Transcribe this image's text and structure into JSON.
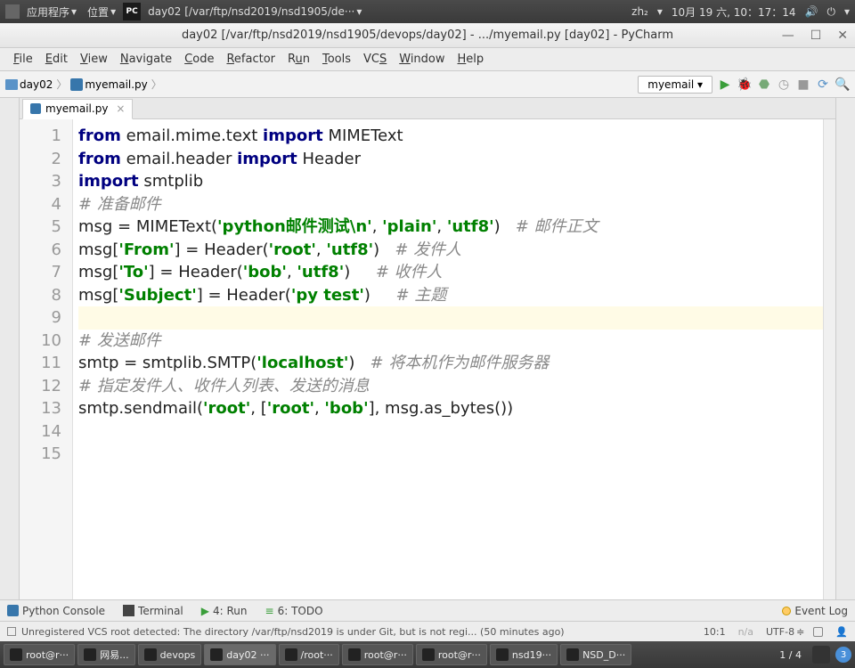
{
  "syspanel": {
    "apps": "应用程序",
    "places": "位置",
    "win_menu": "day02 [/var/ftp/nsd2019/nsd1905/de···",
    "ime": "zh₂",
    "date": "10月 19 六, 10：17：14"
  },
  "title": "day02 [/var/ftp/nsd2019/nsd1905/devops/day02] - .../myemail.py [day02] - PyCharm",
  "menus": [
    "File",
    "Edit",
    "View",
    "Navigate",
    "Code",
    "Refactor",
    "Run",
    "Tools",
    "VCS",
    "Window",
    "Help"
  ],
  "breadcrumb": {
    "root": "day02",
    "file": "myemail.py"
  },
  "run_config": "myemail",
  "file_tab": "myemail.py",
  "code": {
    "lines": [
      [
        [
          "kw",
          "from"
        ],
        [
          "",
          " email.mime.text "
        ],
        [
          "kw",
          "import"
        ],
        [
          "",
          " MIMEText"
        ]
      ],
      [
        [
          "kw",
          "from"
        ],
        [
          "",
          " email.header "
        ],
        [
          "kw",
          "import"
        ],
        [
          "",
          " Header"
        ]
      ],
      [
        [
          "kw",
          "import"
        ],
        [
          "",
          " smtplib"
        ]
      ],
      [
        [
          "",
          ""
        ]
      ],
      [
        [
          "cmt",
          "# 准备邮件"
        ]
      ],
      [
        [
          "",
          "msg = MIMEText("
        ],
        [
          "str",
          "'python邮件测试\\n'"
        ],
        [
          "",
          ", "
        ],
        [
          "str",
          "'plain'"
        ],
        [
          "",
          ", "
        ],
        [
          "str",
          "'utf8'"
        ],
        [
          "",
          ")   "
        ],
        [
          "cmt",
          "# 邮件正文"
        ]
      ],
      [
        [
          "",
          "msg["
        ],
        [
          "str",
          "'From'"
        ],
        [
          "",
          "] = Header("
        ],
        [
          "str",
          "'root'"
        ],
        [
          "",
          ", "
        ],
        [
          "str",
          "'utf8'"
        ],
        [
          "",
          ")   "
        ],
        [
          "cmt",
          "# 发件人"
        ]
      ],
      [
        [
          "",
          "msg["
        ],
        [
          "str",
          "'To'"
        ],
        [
          "",
          "] = Header("
        ],
        [
          "str",
          "'bob'"
        ],
        [
          "",
          ", "
        ],
        [
          "str",
          "'utf8'"
        ],
        [
          "",
          ")     "
        ],
        [
          "cmt",
          "# 收件人"
        ]
      ],
      [
        [
          "",
          "msg["
        ],
        [
          "str",
          "'Subject'"
        ],
        [
          "",
          "] = Header("
        ],
        [
          "str",
          "'py test'"
        ],
        [
          "",
          ")     "
        ],
        [
          "cmt",
          "# 主题"
        ]
      ],
      [
        [
          "hl",
          " "
        ]
      ],
      [
        [
          "cmt",
          "# 发送邮件"
        ]
      ],
      [
        [
          "",
          "smtp = smtplib.SMTP("
        ],
        [
          "str",
          "'localhost'"
        ],
        [
          "",
          ")   "
        ],
        [
          "cmt",
          "# 将本机作为邮件服务器"
        ]
      ],
      [
        [
          "cmt",
          "# 指定发件人、收件人列表、发送的消息"
        ]
      ],
      [
        [
          "",
          "smtp.sendmail("
        ],
        [
          "str",
          "'root'"
        ],
        [
          "",
          ", ["
        ],
        [
          "str",
          "'root'"
        ],
        [
          "",
          ", "
        ],
        [
          "str",
          "'bob'"
        ],
        [
          "",
          "], msg.as_bytes())"
        ]
      ],
      [
        [
          "",
          ""
        ]
      ]
    ]
  },
  "tooltabs": {
    "pyconsole": "Python Console",
    "terminal": "Terminal",
    "run": "4: Run",
    "todo": "6: TODO",
    "eventlog": "Event Log"
  },
  "status": {
    "msg": "Unregistered VCS root detected: The directory /var/ftp/nsd2019 is under Git, but is not regi... (50 minutes ago)",
    "pos": "10:1",
    "na": "n/a",
    "enc": "UTF-8"
  },
  "taskbar": {
    "items": [
      "root@r···",
      "网易...",
      "devops",
      "day02 ···",
      "/root···",
      "root@r···",
      "root@r···",
      "nsd19···",
      "NSD_D···"
    ],
    "workspace": "1  /  4",
    "badge": "3"
  }
}
